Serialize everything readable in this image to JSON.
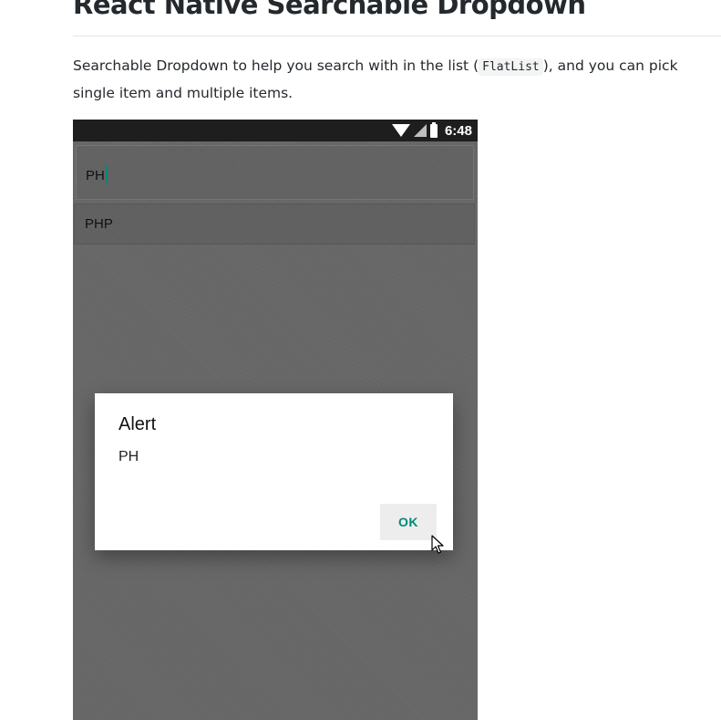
{
  "page": {
    "title": "React Native Searchable Dropdown",
    "description_before": "Searchable Dropdown to help you search with in the list (",
    "description_code": "FlatList",
    "description_after": "), and you can pick single item and multiple items."
  },
  "phone": {
    "status_bar": {
      "time": "6:48",
      "icons": [
        "wifi-icon",
        "signal-icon",
        "battery-icon"
      ]
    },
    "search": {
      "value": "PH"
    },
    "results": [
      {
        "label": "PHP"
      }
    ],
    "alert": {
      "title": "Alert",
      "message": "PH",
      "ok_label": "OK"
    }
  },
  "colors": {
    "accent": "#00897b",
    "overlay": "#6a6a6a",
    "status_bar": "#1e1e1e"
  }
}
